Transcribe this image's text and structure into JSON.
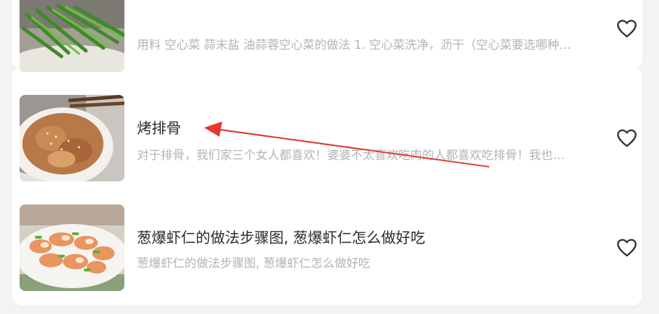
{
  "recipes": [
    {
      "title": "",
      "desc": "用料  空心菜    蒜末盐 油蒜蓉空心菜的做法  1. 空心菜洗净，沥干（空心菜要选哪种…",
      "image": "stir-fried-water-spinach",
      "favorite_icon": "heart-outline-icon"
    },
    {
      "title": "烤排骨",
      "desc": "对于排骨，我们家三个女人都喜欢！婆婆不太喜欢吃肉的人都喜欢吃排骨！我也…",
      "image": "roasted-spare-ribs",
      "favorite_icon": "heart-outline-icon"
    },
    {
      "title": "葱爆虾仁的做法步骤图, 葱爆虾仁怎么做好吃",
      "desc": "葱爆虾仁的做法步骤图, 葱爆虾仁怎么做好吃",
      "image": "scallion-fried-shrimp",
      "favorite_icon": "heart-outline-icon"
    }
  ],
  "colors": {
    "page_bg": "#f3f3f3",
    "card_bg": "#ffffff",
    "title": "#2b2b2b",
    "desc": "#b3b3b3",
    "icon": "#333333",
    "annotation_arrow": "#e23b2e"
  }
}
